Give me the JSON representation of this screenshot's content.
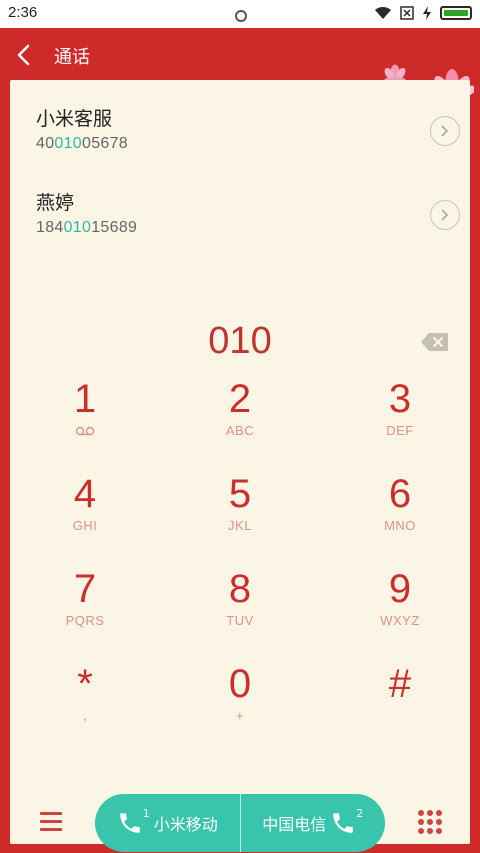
{
  "status_bar": {
    "time": "2:36"
  },
  "header": {
    "title": "通话"
  },
  "contacts": [
    {
      "name": "小米客服",
      "number_pre": "40",
      "number_match": "010",
      "number_post": "05678"
    },
    {
      "name": "燕婷",
      "number_pre": "184",
      "number_match": "010",
      "number_post": "15689"
    }
  ],
  "dial_input": {
    "value": "010"
  },
  "keypad": [
    {
      "digit": "1",
      "letters": ""
    },
    {
      "digit": "2",
      "letters": "ABC"
    },
    {
      "digit": "3",
      "letters": "DEF"
    },
    {
      "digit": "4",
      "letters": "GHI"
    },
    {
      "digit": "5",
      "letters": "JKL"
    },
    {
      "digit": "6",
      "letters": "MNO"
    },
    {
      "digit": "7",
      "letters": "PQRS"
    },
    {
      "digit": "8",
      "letters": "TUV"
    },
    {
      "digit": "9",
      "letters": "WXYZ"
    },
    {
      "digit": "*",
      "letters": ","
    },
    {
      "digit": "0",
      "letters": "+"
    },
    {
      "digit": "#",
      "letters": ""
    }
  ],
  "call_buttons": {
    "sim1_label": "小米移动",
    "sim1_index": "1",
    "sim2_label": "中国电信",
    "sim2_index": "2"
  },
  "colors": {
    "theme_red": "#cf2a2a",
    "accent_green": "#38c5ac",
    "match_highlight": "#33b79a"
  }
}
